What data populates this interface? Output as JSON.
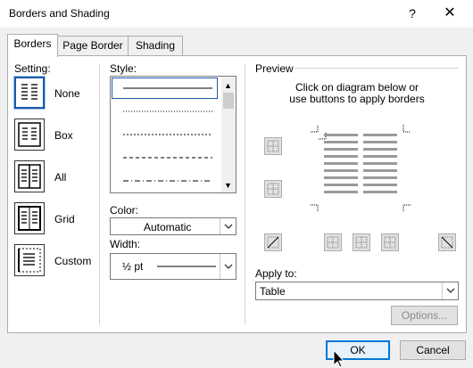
{
  "window": {
    "title": "Borders and Shading",
    "help_label": "?",
    "close_label": "✕"
  },
  "tabs": [
    {
      "label": "Borders",
      "active": true
    },
    {
      "label": "Page Border",
      "active": false
    },
    {
      "label": "Shading",
      "active": false
    }
  ],
  "setting": {
    "label": "Setting:",
    "items": [
      {
        "label": "None",
        "selected": true
      },
      {
        "label": "Box",
        "selected": false
      },
      {
        "label": "All",
        "selected": false
      },
      {
        "label": "Grid",
        "selected": false
      },
      {
        "label": "Custom",
        "selected": false
      }
    ]
  },
  "style": {
    "label": "Style:",
    "line_styles": [
      "solid",
      "dotted",
      "dashed-small",
      "dashed",
      "dash-dot"
    ],
    "selected_index": 0
  },
  "color": {
    "label": "Color:",
    "value": "Automatic"
  },
  "width": {
    "label": "Width:",
    "value": "½ pt"
  },
  "preview": {
    "label": "Preview",
    "instructions_line1": "Click on diagram below or",
    "instructions_line2": "use buttons to apply borders"
  },
  "apply_to": {
    "label": "Apply to:",
    "value": "Table"
  },
  "buttons": {
    "options": "Options...",
    "ok": "OK",
    "cancel": "Cancel"
  },
  "colors": {
    "accent": "#0078d7",
    "selection": "#1a5aa6",
    "panel_bg": "#ffffff",
    "dialog_bg": "#f0f0f0"
  }
}
